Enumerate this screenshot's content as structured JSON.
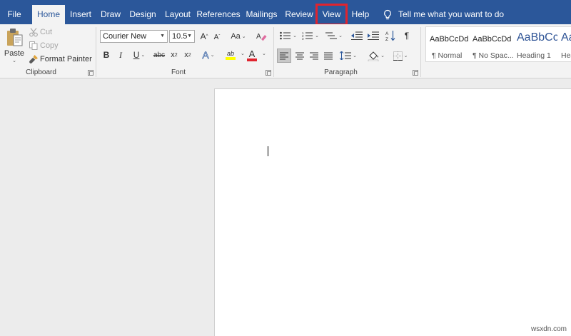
{
  "tabs": {
    "file": "File",
    "home": "Home",
    "insert": "Insert",
    "draw": "Draw",
    "design": "Design",
    "layout": "Layout",
    "references": "References",
    "mailings": "Mailings",
    "review": "Review",
    "view": "View",
    "help": "Help"
  },
  "tell_me": "Tell me what you want to do",
  "clipboard": {
    "paste": "Paste",
    "cut": "Cut",
    "copy": "Copy",
    "format_painter": "Format Painter",
    "label": "Clipboard"
  },
  "font": {
    "family": "Courier New",
    "size": "10.5",
    "grow": "A",
    "shrink": "A",
    "case": "Aa",
    "bold": "B",
    "italic": "I",
    "underline": "U",
    "strike": "abc",
    "subscript_base": "x",
    "subscript_mark": "2",
    "superscript_base": "x",
    "superscript_mark": "2",
    "effects": "A",
    "highlight": "ab",
    "color": "A",
    "label": "Font"
  },
  "paragraph": {
    "label": "Paragraph",
    "pilcrow": "¶"
  },
  "styles": {
    "items": [
      {
        "sample": "AaBbCcDd",
        "name": "¶ Normal"
      },
      {
        "sample": "AaBbCcDd",
        "name": "¶ No Spac..."
      },
      {
        "sample": "AaBbCc",
        "name": "Heading 1"
      },
      {
        "sample": "AaBbCc",
        "name": "Hea"
      }
    ]
  },
  "watermark": "wsxdn.com",
  "colors": {
    "tab_bar": "#2b579a",
    "ribbon": "#f3f3f3",
    "highlight_box": "#e0242e",
    "font_color_bar": "#e0242e",
    "highlight_bar": "#ffff00",
    "heading_color": "#2f5496"
  }
}
